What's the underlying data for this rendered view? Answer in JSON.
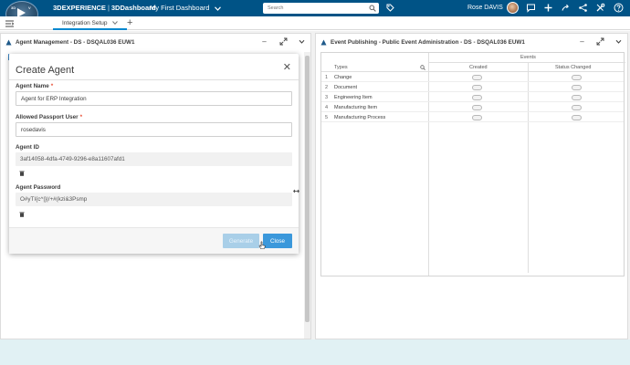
{
  "topbar": {
    "brand_primary": "3DEXPERIENCE",
    "brand_separator": "|",
    "brand_app": "3DDashboard",
    "dashboard_title": "My First Dashboard",
    "search_placeholder": "Search",
    "user_name": "Rose DAVIS",
    "compass_quadrants": [
      "3D",
      "V",
      "V+R",
      "ON"
    ]
  },
  "tabs": {
    "active_label": "Integration Setup",
    "add_label": "+"
  },
  "left_widget": {
    "title": "Agent Management - DS - DSQAL036 EUW1"
  },
  "modal": {
    "title": "Create Agent",
    "close_glyph": "✕",
    "agent_name_label": "Agent Name",
    "agent_name_value": "Agent for ERP Integration",
    "passport_user_label": "Allowed Passport User",
    "passport_user_value": "rosedavis",
    "agent_id_label": "Agent ID",
    "agent_id_value": "3af14058-4dfa-4749-9296-e8a11607afd1",
    "agent_password_label": "Agent Password",
    "agent_password_value": "O#yTI{c^|}|/+#(kzi&3Psmp",
    "required_mark": "*",
    "generate_label": "Generate",
    "close_label": "Close"
  },
  "right_widget": {
    "title": "Event Publishing - Public Event Administration - DS - DSQAL036 EUW1",
    "events_header": "Events",
    "types_header": "Types",
    "created_header": "Created",
    "status_changed_header": "Status Changed",
    "rows": [
      {
        "num": "1",
        "type": "Change"
      },
      {
        "num": "2",
        "type": "Document"
      },
      {
        "num": "3",
        "type": "Engineering Item"
      },
      {
        "num": "4",
        "type": "Manufacturing Item"
      },
      {
        "num": "5",
        "type": "Manufacturing Process"
      }
    ]
  },
  "colors": {
    "topbar": "#005386",
    "primary_button": "#3b98db",
    "disabled_button": "#a9cfe8",
    "required": "#ea4f37"
  }
}
